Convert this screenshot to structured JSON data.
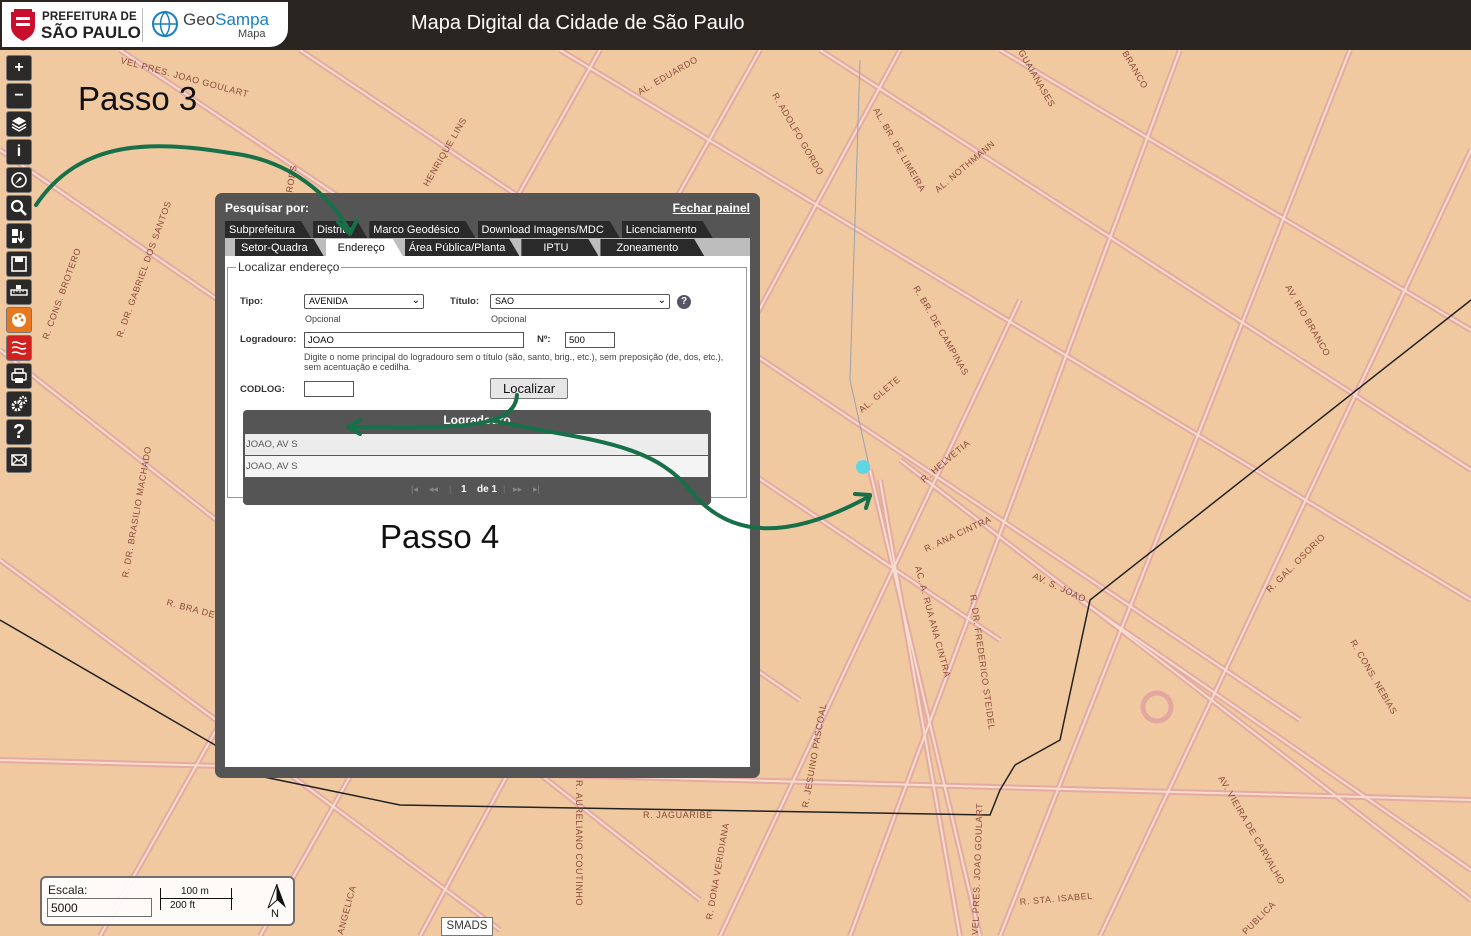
{
  "header": {
    "org_line1": "PREFEITURA DE",
    "org_line2": "SÃO PAULO",
    "brand_geo": "Geo",
    "brand_sampa": "Sampa",
    "brand_sub": "Mapa",
    "title": "Mapa Digital da Cidade de São Paulo"
  },
  "toolbar": {
    "items": [
      {
        "name": "zoom-in",
        "icon": "plus-icon"
      },
      {
        "name": "zoom-out",
        "icon": "minus-icon"
      },
      {
        "name": "layers",
        "icon": "layers-icon"
      },
      {
        "name": "info",
        "icon": "info-icon"
      },
      {
        "name": "measure",
        "icon": "compass-icon"
      },
      {
        "name": "search",
        "icon": "search-icon"
      },
      {
        "name": "route",
        "icon": "route-icon"
      },
      {
        "name": "save",
        "icon": "save-icon"
      },
      {
        "name": "ruler",
        "icon": "ruler-icon"
      },
      {
        "name": "palette",
        "icon": "palette-icon"
      },
      {
        "name": "heatmap",
        "icon": "wave-icon"
      },
      {
        "name": "print",
        "icon": "printer-icon"
      },
      {
        "name": "settings",
        "icon": "gears-icon"
      },
      {
        "name": "help",
        "icon": "question-icon"
      },
      {
        "name": "contact",
        "icon": "envelope-icon"
      }
    ]
  },
  "annotations": {
    "passo3": "Passo 3",
    "passo4": "Passo 4",
    "arrow_color": "#17704a"
  },
  "panel": {
    "heading": "Pesquisar por:",
    "close": "Fechar painel",
    "tabs_row1": [
      "Subprefeitura",
      "Distrito",
      "Marco Geodésico",
      "Download Imagens/MDC",
      "Licenciamento"
    ],
    "tabs_row2": [
      "Setor-Quadra",
      "Endereço",
      "Área Pública/Planta",
      "IPTU",
      "Zoneamento"
    ],
    "active_tab": "Endereço",
    "form": {
      "legend": "Localizar endereço",
      "tipo_label": "Tipo:",
      "tipo_value": "AVENIDA",
      "tipo_hint": "Opcional",
      "titulo_label": "Título:",
      "titulo_value": "SAO",
      "titulo_hint": "Opcional",
      "logradouro_label": "Logradouro:",
      "logradouro_value": "JOAO",
      "numero_label": "Nº:",
      "numero_value": "500",
      "hint": "Digite o nome principal do logradouro sem o título (são, santo, brig., etc.), sem preposição (de, dos, etc.), sem acentuação e cedilha.",
      "codlog_label": "CODLOG:",
      "codlog_value": "",
      "submit": "Localizar"
    },
    "results": {
      "header": "Logradouro",
      "rows": [
        "JOAO, AV S",
        "JOAO, AV S"
      ],
      "page": "1",
      "of": "de 1"
    }
  },
  "map": {
    "labels": {
      "vel_pres": "VEL PRES. JOAO GOULART",
      "eduardo": "AL. EDUARDO",
      "adolfo": "R. ADOLFO GORDO",
      "limeira": "AL. BR. DE LIMEIRA",
      "nothmann": "AL. NOTHMANN",
      "guaianases": "GUAIANASES",
      "branco": "BRANCO",
      "rio_branco": "AV. RIO BRANCO",
      "campinas": "R. BR. DE CAMPINAS",
      "glete": "AL. GLETE",
      "helvetia": "R. HELVETIA",
      "ana_cintra_h": "R. ANA CINTRA",
      "av_s_joao": "AV. S. JOAO",
      "gal_osorio": "R. GAL. OSORIO",
      "cons_nebias": "R. CONS. NEBIAS",
      "vieira": "AV. VIEIRA DE CARVALHO",
      "sta_isabel": "R. STA. ISABEL",
      "ana_cintra_v": "AC. A. RUA ANA CINTRA",
      "frederico": "R. DR. FREDERICO STEIDEL",
      "jesuino": "R. JESUINO PASCOAL",
      "jaguaribe": "R. JAGUARIBE",
      "dona_veridiana": "R. DONA VERIDIANA",
      "aureliano": "R. AURELIANO COUTINHO",
      "joao_goulart_v": "VEL PRES. JOAO GOULART",
      "cons_brotero": "R. CONS. BROTERO",
      "gabriel": "R. DR. GABRIEL DOS SANTOS",
      "brasilio": "R. DR. BRASILIO MACHADO",
      "bra_de": "R. BRA DE",
      "henrique": "HENRIQUE LINS",
      "angelica": "ANGELICA",
      "publica": "PUBLICA",
      "roes": "ROES"
    },
    "marker_color": "#5fd6e6"
  },
  "scale": {
    "label": "Escala:",
    "value": "5000",
    "bar_m": "100 m",
    "bar_ft": "200 ft",
    "north": "N"
  },
  "footer": {
    "badge": "SMADS"
  }
}
